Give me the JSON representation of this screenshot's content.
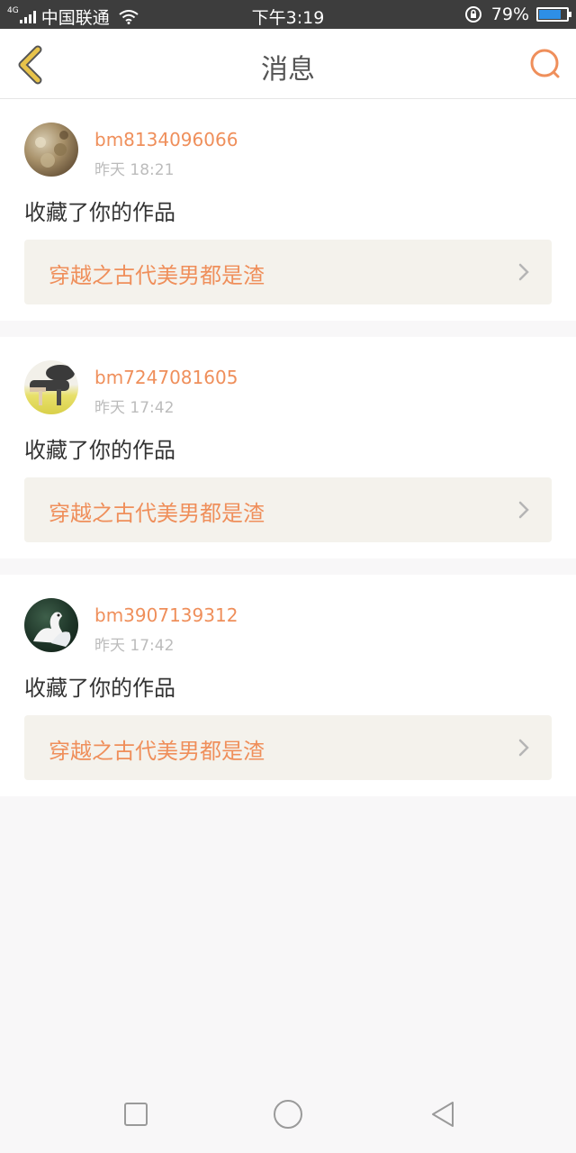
{
  "status_bar": {
    "network": "4G",
    "carrier": "中国联通",
    "time": "下午3:19",
    "battery_percent_text": "79%",
    "battery_level": 0.79
  },
  "header": {
    "title": "消息",
    "back_icon": "chevron-left-icon",
    "search_icon": "search-icon"
  },
  "colors": {
    "accent": "#ef8f5b",
    "back_icon": "#e8c34a",
    "link_bg": "#f4f2ec"
  },
  "messages": [
    {
      "username": "bm8134096066",
      "time": "昨天 18:21",
      "action": "收藏了你的作品",
      "work_title": "穿越之古代美男都是渣"
    },
    {
      "username": "bm7247081605",
      "time": "昨天 17:42",
      "action": "收藏了你的作品",
      "work_title": "穿越之古代美男都是渣"
    },
    {
      "username": "bm3907139312",
      "time": "昨天 17:42",
      "action": "收藏了你的作品",
      "work_title": "穿越之古代美男都是渣"
    }
  ],
  "nav_bar": {
    "recent_icon": "square-icon",
    "home_icon": "circle-icon",
    "back_icon": "triangle-back-icon"
  }
}
